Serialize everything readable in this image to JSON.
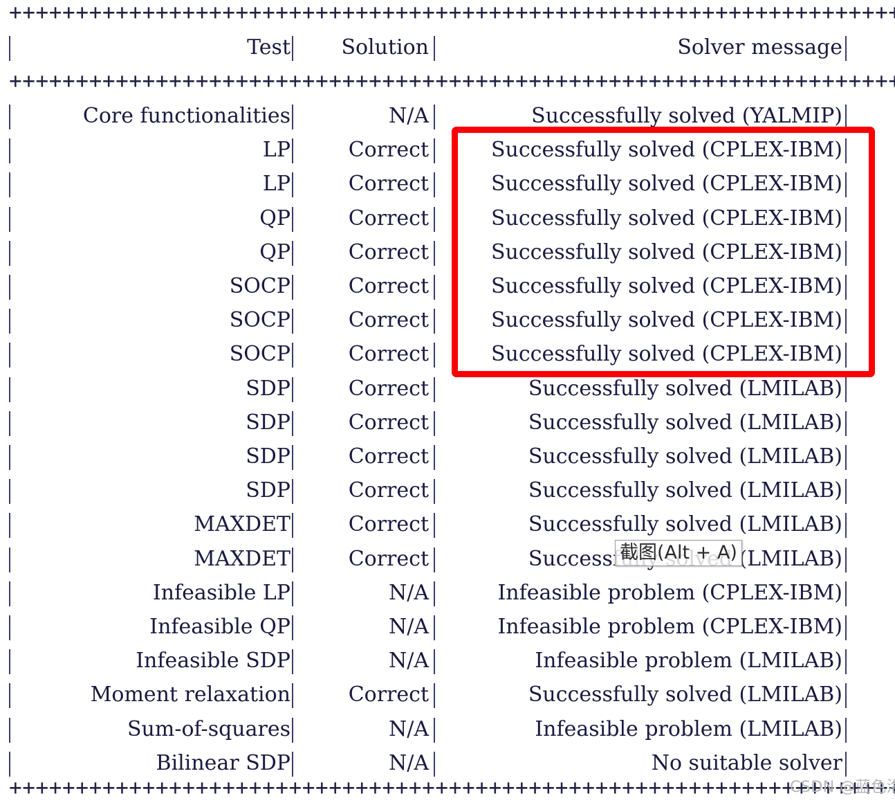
{
  "console": {
    "separator": "++++++++++++++++++++++++++++++++++++++++++++++++++++++++++++++++++++++++++++++++",
    "pipe": "|"
  },
  "table": {
    "headers": {
      "test": "Test",
      "solution": "Solution",
      "message": "Solver message"
    },
    "rows": [
      {
        "test": "Core functionalities",
        "solution": "N/A",
        "message": "Successfully solved (YALMIP)"
      },
      {
        "test": "LP",
        "solution": "Correct",
        "message": "Successfully solved (CPLEX-IBM)"
      },
      {
        "test": "LP",
        "solution": "Correct",
        "message": "Successfully solved (CPLEX-IBM)"
      },
      {
        "test": "QP",
        "solution": "Correct",
        "message": "Successfully solved (CPLEX-IBM)"
      },
      {
        "test": "QP",
        "solution": "Correct",
        "message": "Successfully solved (CPLEX-IBM)"
      },
      {
        "test": "SOCP",
        "solution": "Correct",
        "message": "Successfully solved (CPLEX-IBM)"
      },
      {
        "test": "SOCP",
        "solution": "Correct",
        "message": "Successfully solved (CPLEX-IBM)"
      },
      {
        "test": "SOCP",
        "solution": "Correct",
        "message": "Successfully solved (CPLEX-IBM)"
      },
      {
        "test": "SDP",
        "solution": "Correct",
        "message": "Successfully solved (LMILAB)"
      },
      {
        "test": "SDP",
        "solution": "Correct",
        "message": "Successfully solved (LMILAB)"
      },
      {
        "test": "SDP",
        "solution": "Correct",
        "message": "Successfully solved (LMILAB)"
      },
      {
        "test": "SDP",
        "solution": "Correct",
        "message": "Successfully solved (LMILAB)"
      },
      {
        "test": "MAXDET",
        "solution": "Correct",
        "message": "Successfully solved (LMILAB)"
      },
      {
        "test": "MAXDET",
        "solution": "Correct",
        "message": "Successfully solved (LMILAB)"
      },
      {
        "test": "Infeasible LP",
        "solution": "N/A",
        "message": "Infeasible problem (CPLEX-IBM)"
      },
      {
        "test": "Infeasible QP",
        "solution": "N/A",
        "message": "Infeasible problem (CPLEX-IBM)"
      },
      {
        "test": "Infeasible SDP",
        "solution": "N/A",
        "message": "Infeasible problem (LMILAB)"
      },
      {
        "test": "Moment relaxation",
        "solution": "Correct",
        "message": "Successfully solved (LMILAB)"
      },
      {
        "test": "Sum-of-squares",
        "solution": "N/A",
        "message": "Infeasible problem (LMILAB)"
      },
      {
        "test": "Bilinear SDP",
        "solution": "N/A",
        "message": "No suitable solver"
      }
    ]
  },
  "annotation": {
    "highlight_color": "#fb0004",
    "highlight_rows": [
      1,
      2,
      3,
      4,
      5,
      6,
      7
    ]
  },
  "tooltip": {
    "label": "截图(Alt + A)"
  },
  "watermark": {
    "text": "CSDN @蓝色洛特"
  }
}
